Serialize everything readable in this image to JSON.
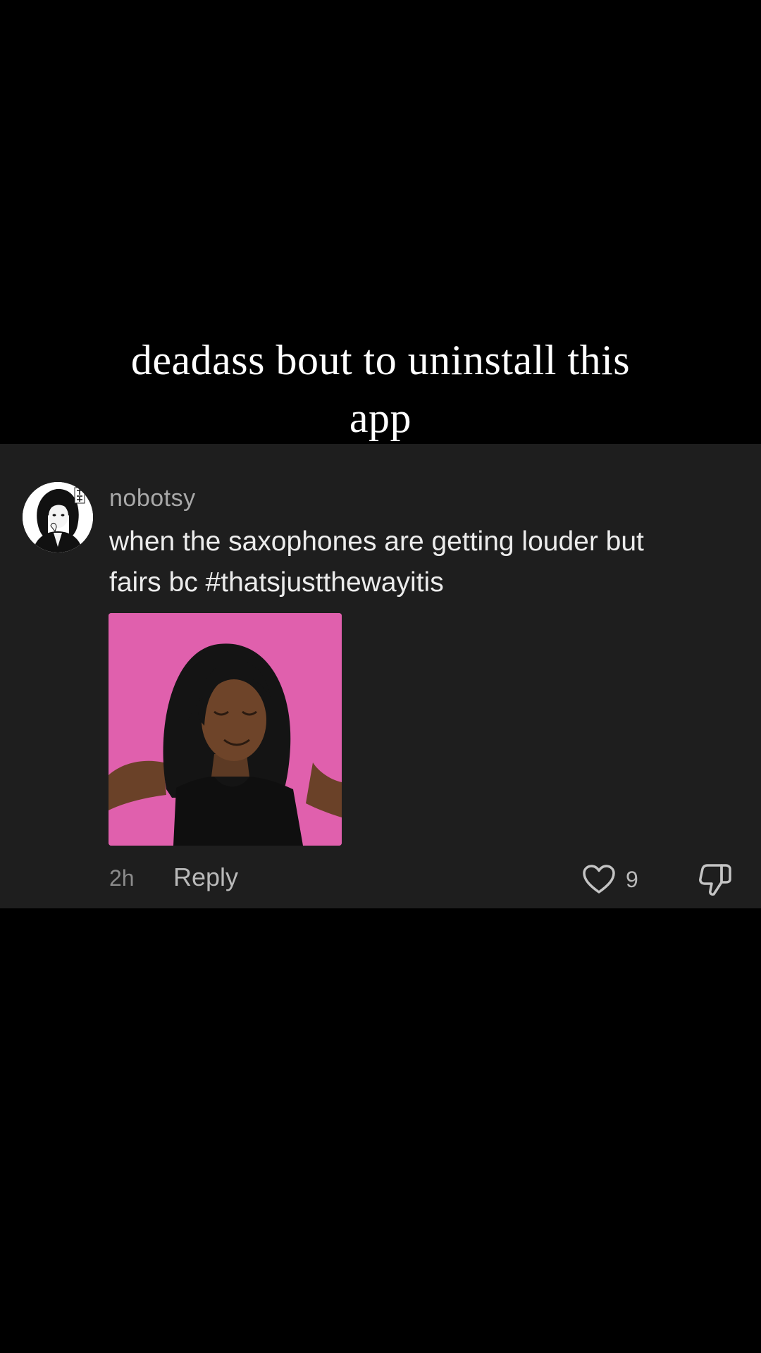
{
  "caption": {
    "line1": "deadass bout to uninstall this",
    "line2": "app"
  },
  "comment": {
    "username": "nobotsy",
    "text_line1": "when the saxophones are getting louder but",
    "text_line2": "fairs bc #thatsjustthewayitis",
    "gif": {
      "icon": "reaction-gif",
      "background_color": "#e060ad"
    },
    "timestamp": "2h",
    "reply_label": "Reply",
    "like_count": "9"
  },
  "colors": {
    "background": "#000000",
    "card": "#1e1e1e",
    "text_primary": "#ececec",
    "text_muted": "#a9a9a9"
  }
}
